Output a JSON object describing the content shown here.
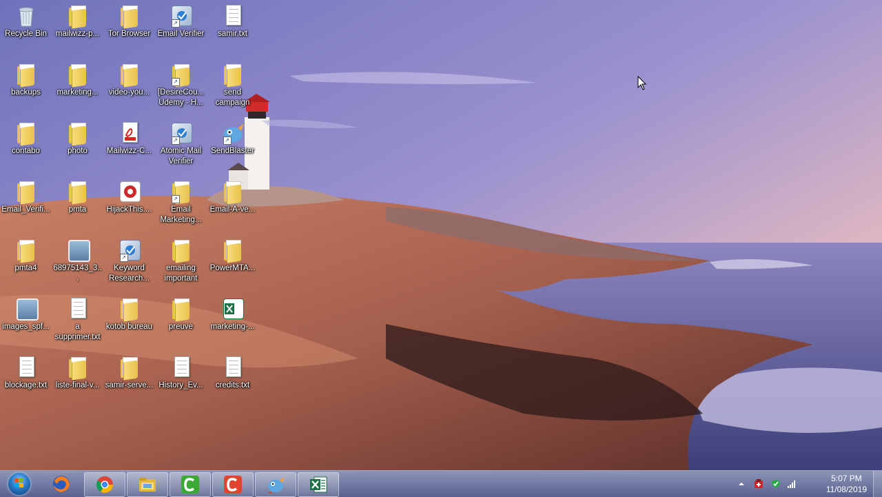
{
  "desktop": {
    "icons": [
      {
        "label": "Recycle Bin",
        "icon": "recycle-bin-icon"
      },
      {
        "label": "mailwizz-p...",
        "icon": "folder-icon"
      },
      {
        "label": "Tor Browser",
        "icon": "folder-icon"
      },
      {
        "label": "Email Verifier",
        "icon": "app-shortcut-icon"
      },
      {
        "label": "samir.txt",
        "icon": "text-file-icon"
      },
      {
        "label": "backups",
        "icon": "folder-icon"
      },
      {
        "label": "marketing...",
        "icon": "folder-icon"
      },
      {
        "label": "video-you...",
        "icon": "folder-icon"
      },
      {
        "label": "[DesireCou... Udemy - H...",
        "icon": "folder-shortcut-icon"
      },
      {
        "label": "send campaign",
        "icon": "folder-icon"
      },
      {
        "label": "contabo",
        "icon": "folder-icon"
      },
      {
        "label": "photo",
        "icon": "folder-icon"
      },
      {
        "label": "Mailwizz-C...",
        "icon": "pdf-file-icon"
      },
      {
        "label": "Atomic Mail Verifier",
        "icon": "app-shortcut-icon"
      },
      {
        "label": "SendBlaster",
        "icon": "sendblaster-icon"
      },
      {
        "label": "Email_Verifi...",
        "icon": "folder-icon"
      },
      {
        "label": "pmta",
        "icon": "folder-icon"
      },
      {
        "label": "HijackThis....",
        "icon": "hijackthis-icon"
      },
      {
        "label": "Email Marketing...",
        "icon": "folder-shortcut-icon"
      },
      {
        "label": "Email-A-ve...",
        "icon": "folder-icon"
      },
      {
        "label": "pmta4",
        "icon": "folder-icon"
      },
      {
        "label": "68975143_3...",
        "icon": "image-file-icon"
      },
      {
        "label": "Keyword Research...",
        "icon": "app-shortcut-icon"
      },
      {
        "label": "emailing important",
        "icon": "folder-icon"
      },
      {
        "label": "PowerMTA...",
        "icon": "folder-icon"
      },
      {
        "label": "images_spf...",
        "icon": "image-file-icon"
      },
      {
        "label": "a supprimer.txt",
        "icon": "text-file-icon"
      },
      {
        "label": "kotob bureau",
        "icon": "folder-icon"
      },
      {
        "label": "preuve",
        "icon": "folder-icon"
      },
      {
        "label": "marketing-...",
        "icon": "excel-file-icon"
      },
      {
        "label": "blockage.txt",
        "icon": "text-file-icon"
      },
      {
        "label": "liste-final-v...",
        "icon": "folder-icon"
      },
      {
        "label": "samir-serve...",
        "icon": "folder-icon"
      },
      {
        "label": "History_Ev...",
        "icon": "file-icon"
      },
      {
        "label": "credits.txt",
        "icon": "text-file-icon"
      }
    ]
  },
  "taskbar": {
    "pinned": [
      {
        "name": "start-button"
      },
      {
        "name": "firefox",
        "icon": "firefox-icon"
      },
      {
        "name": "chrome",
        "icon": "chrome-icon"
      },
      {
        "name": "file-explorer",
        "icon": "file-explorer-icon"
      },
      {
        "name": "camtasia-green",
        "icon": "camtasia-recorder-icon"
      },
      {
        "name": "camtasia-red",
        "icon": "camtasia-studio-icon"
      },
      {
        "name": "sendblaster",
        "icon": "sendblaster-icon"
      },
      {
        "name": "excel",
        "icon": "excel-icon"
      }
    ],
    "tray": {
      "time": "5:07 PM",
      "date": "11/08/2019",
      "icons": [
        "show-hidden-icons-arrow",
        "antivirus-icon",
        "security-shield-icon",
        "network-signal-icon"
      ]
    }
  },
  "colors": {
    "sky_top": "#7d7fc4",
    "sky_horizon": "#f3c2a4",
    "sea": "#5a5aa0",
    "rock": "#b06a55",
    "taskbar": "#5a6496",
    "folder": "#e9c24d"
  }
}
